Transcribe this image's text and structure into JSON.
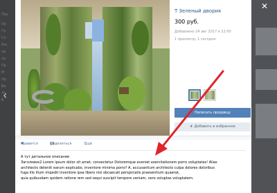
{
  "item": {
    "title": "Т Зеленый дворик",
    "price": "300 руб.",
    "date": "Добавлено 24 авг 2017 в 22:00",
    "views": "1 просмотр, 1 сегодня"
  },
  "buttons": {
    "message": "Написать продавцу",
    "favorite": "Добавить в избранное"
  },
  "actions": {
    "like": "Нравится",
    "share": "Поделиться",
    "more": "Ещё"
  },
  "description": {
    "title": "А тут детальное описание",
    "lines": [
      "Заголовок2 Lorem ipsum dolor sit amet, consectetur Doloremque eveniet exercitationem porro voluptates! Alias",
      "architecto deleniti earum explicabo, inventore minima porro? A, accusantium architecto culpa dolores doloribus",
      "fuga illo illum impedit inventore ipsa libero nisi obcaecati perspiciatis praesentium quaerat,",
      "quia quibusdam quidem ratione rem sed sequi suscipit tempore veniam, vero voluptas voluptatem."
    ]
  },
  "background": {
    "left_fragments": [
      "Пру",
      "Ор",
      "Гр",
      "Со",
      "Рес",
      "пр",
      "пр",
      "Пр",
      "М",
      "Нр",
      "Ви",
      "Ло",
      "В"
    ]
  },
  "icons": {
    "close": "close-icon",
    "prev": "chevron-left-icon",
    "like": "heart-icon",
    "share": "megaphone-icon",
    "more": "chevron-down-icon",
    "favorite": "star-icon"
  },
  "colors": {
    "accent": "#5181b8",
    "link": "#2a5885",
    "arrow": "#e0242a"
  }
}
